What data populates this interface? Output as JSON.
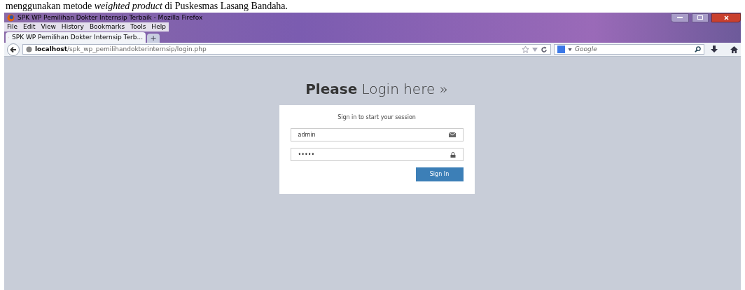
{
  "document_caption": "menggunakan metode *weighted product* di Puskesmas Lasang Bandaha.",
  "window": {
    "title": "SPK WP Pemilihan Dokter Internsip Terbaik - Mozilla Firefox"
  },
  "menu": [
    "File",
    "Edit",
    "View",
    "History",
    "Bookmarks",
    "Tools",
    "Help"
  ],
  "tabs": [
    {
      "label": "SPK WP Pemilihan Dokter Internsip Terb...",
      "selected": true
    }
  ],
  "new_tab": "+",
  "address_bar": {
    "host": "localhost",
    "path": "/spk_wp_pemilihandokterinternsip/login.php"
  },
  "search_bar": {
    "placeholder": "Google"
  },
  "page": {
    "heading_bold": "Please",
    "heading_rest": "Login here »",
    "box_message": "Sign in to start your session",
    "username": "admin",
    "password": "•••••",
    "button": "Sign In"
  }
}
